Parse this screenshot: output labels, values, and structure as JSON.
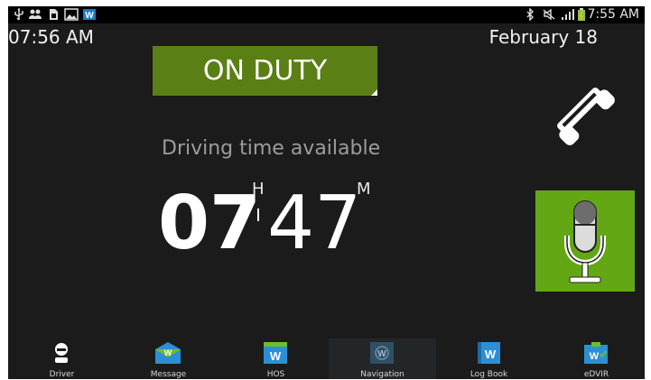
{
  "status_bar": {
    "time": "7:55 AM",
    "left_icons": [
      "usb-icon",
      "contacts-icon",
      "sd-card-icon",
      "image-icon",
      "app-w-icon"
    ],
    "right_icons": [
      "bluetooth-icon",
      "mute-icon",
      "signal-icon",
      "battery-icon"
    ]
  },
  "header": {
    "clock": "07:56 AM",
    "date": "February 18"
  },
  "duty": {
    "status_label": "ON DUTY",
    "color": "#5a7f14"
  },
  "driving": {
    "label": "Driving time available",
    "hours": "07",
    "hours_unit": "H",
    "minutes": "47",
    "minutes_unit": "M"
  },
  "actions": {
    "phone_icon": "phone-icon",
    "mic_icon": "microphone-icon",
    "mic_bg": "#63a814"
  },
  "nav": {
    "items": [
      {
        "label": "Driver",
        "icon": "driver-icon"
      },
      {
        "label": "Message",
        "icon": "message-icon"
      },
      {
        "label": "HOS",
        "icon": "hos-icon"
      },
      {
        "label": "Navigation",
        "icon": "navigation-icon",
        "active": true
      },
      {
        "label": "Log Book",
        "icon": "logbook-icon"
      },
      {
        "label": "eDVIR",
        "icon": "edvir-icon"
      }
    ]
  }
}
